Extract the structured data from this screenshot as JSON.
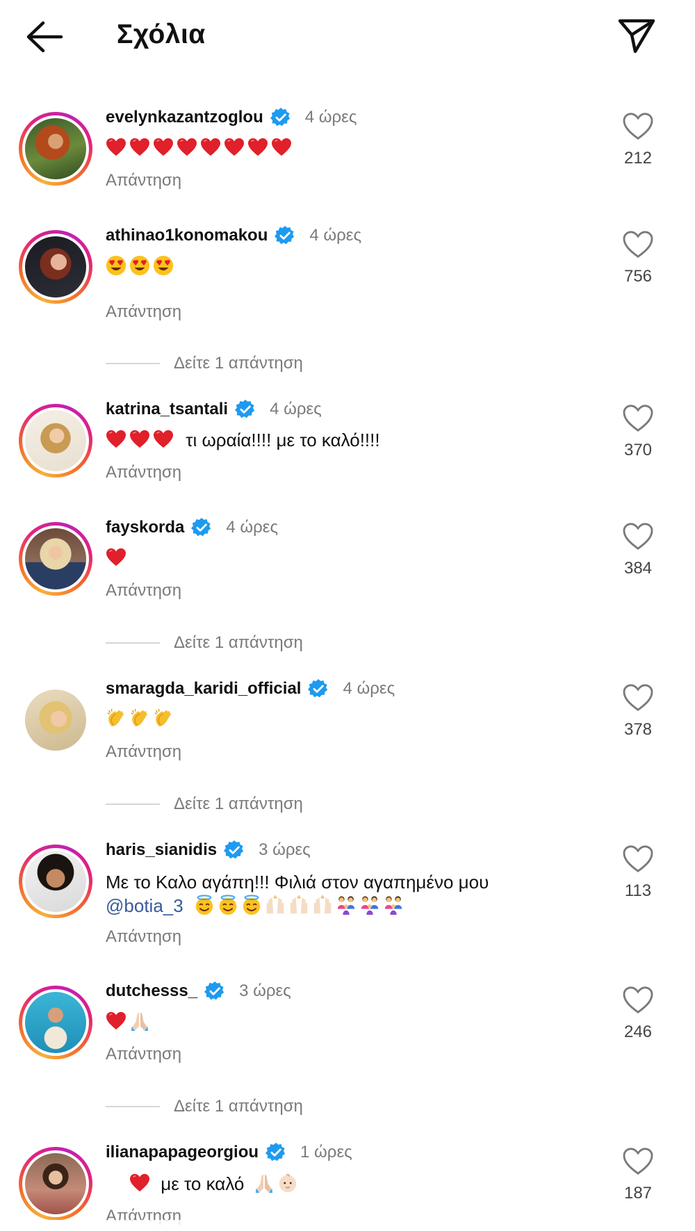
{
  "header": {
    "title": "Σχόλια"
  },
  "reply_label": "Απάντηση",
  "view_replies_label": "Δείτε 1 απάντηση",
  "comments": [
    {
      "username": "evelynkazantzoglou",
      "time": "4 ώρες",
      "likes": "212",
      "emoji": [
        "heart",
        "heart",
        "heart",
        "heart",
        "heart",
        "heart",
        "heart",
        "heart"
      ],
      "text": ""
    },
    {
      "username": "athinao1konomakou",
      "time": "4 ώρες",
      "likes": "756",
      "emoji": [
        "heart-eyes",
        "heart-eyes",
        "heart-eyes"
      ],
      "text": ""
    },
    {
      "username": "katrina_tsantali",
      "time": "4 ώρες",
      "likes": "370",
      "emoji": [
        "heart",
        "heart",
        "heart"
      ],
      "text": "τι ωραία!!!! με το καλό!!!!"
    },
    {
      "username": "fayskorda",
      "time": "4 ώρες",
      "likes": "384",
      "emoji": [
        "heart"
      ],
      "text": ""
    },
    {
      "username": "smaragda_karidi_official",
      "time": "4 ώρες",
      "likes": "378",
      "emoji": [
        "clap",
        "clap",
        "clap"
      ],
      "text": ""
    },
    {
      "username": "haris_sianidis",
      "time": "3 ώρες",
      "likes": "113",
      "text": "Με το Καλο αγάπη!!! Φιλιά στον αγαπημένο μου",
      "mention": "@botia_3",
      "emoji": [
        "halo",
        "halo",
        "halo",
        "raised-hands",
        "raised-hands",
        "raised-hands",
        "family",
        "family",
        "family"
      ]
    },
    {
      "username": "dutchesss_",
      "time": "3 ώρες",
      "likes": "246",
      "emoji": [
        "heart",
        "pray"
      ],
      "text": ""
    },
    {
      "username": "ilianapapageorgiou",
      "time": "1 ώρες",
      "likes": "187",
      "emoji": [
        "heart"
      ],
      "text": "με το καλό",
      "emoji_after": [
        "pray",
        "baby"
      ]
    }
  ],
  "colors": {
    "verified": "#1d9bf0",
    "heart_emoji": "#e0202a",
    "muted_text": "#7a7a7a",
    "mention": "#385a9a"
  },
  "icons": {
    "back": "arrow-left-icon",
    "send": "paper-plane-icon",
    "like": "heart-outline-icon",
    "verified": "verified-badge-icon"
  }
}
